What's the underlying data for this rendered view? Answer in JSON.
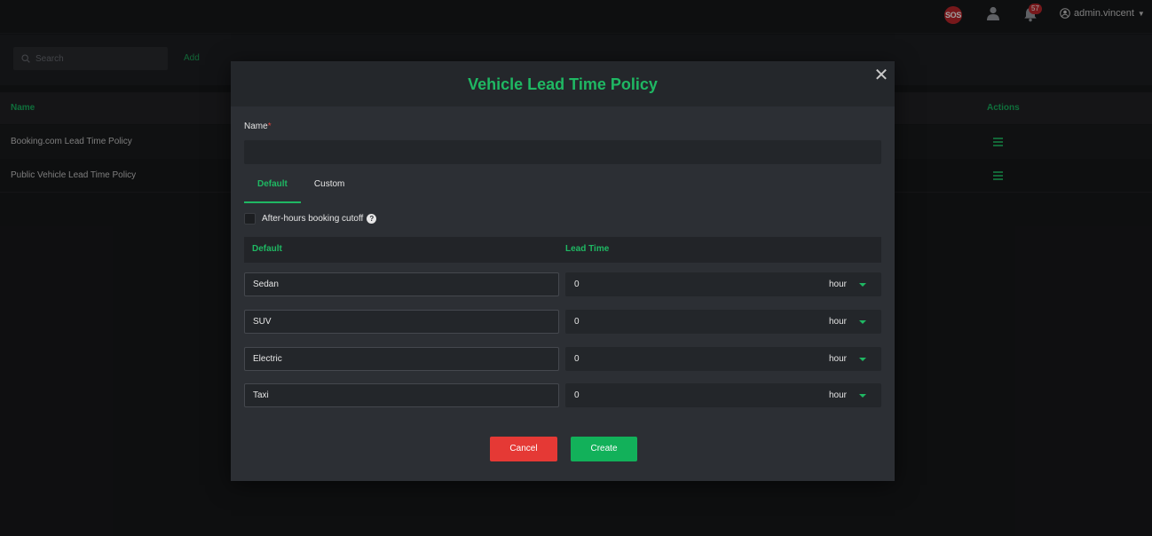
{
  "topbar": {
    "sos_label": "SOS",
    "notification_count": "57",
    "username": "admin.vincent"
  },
  "toolbar": {
    "search_placeholder": "Search",
    "add_label": "Add"
  },
  "table": {
    "columns": {
      "name": "Name",
      "actions": "Actions"
    },
    "rows": [
      {
        "name": "Booking.com Lead Time Policy"
      },
      {
        "name": "Public Vehicle Lead Time Policy"
      }
    ]
  },
  "modal": {
    "title": "Vehicle Lead Time Policy",
    "close_symbol": "✕",
    "name_label": "Name",
    "required_mark": "*",
    "name_value": "",
    "tabs": [
      {
        "label": "Default",
        "active": true
      },
      {
        "label": "Custom",
        "active": false
      }
    ],
    "after_hours_label": "After-hours booking cutoff",
    "after_hours_checked": false,
    "help_symbol": "?",
    "lead_time_table": {
      "col_default": "Default",
      "col_lead_time": "Lead Time",
      "rows": [
        {
          "vehicle": "Sedan",
          "value": "0",
          "unit": "hour"
        },
        {
          "vehicle": "SUV",
          "value": "0",
          "unit": "hour"
        },
        {
          "vehicle": "Electric",
          "value": "0",
          "unit": "hour"
        },
        {
          "vehicle": "Taxi",
          "value": "0",
          "unit": "hour"
        }
      ]
    },
    "cancel_label": "Cancel",
    "create_label": "Create"
  },
  "colors": {
    "accent_green": "#1fb863",
    "danger_red": "#e53935",
    "badge_red": "#c0282d",
    "background": "#18191b",
    "modal_bg": "#2c2f34"
  },
  "icons": {
    "sos": "sos-icon",
    "user": "user-icon",
    "bell": "bell-icon",
    "account": "account-circle-icon",
    "search": "search-icon",
    "row_menu": "hamburger-menu-icon",
    "close": "close-icon",
    "help": "question-circle-icon",
    "dropdown": "chevron-down-icon"
  }
}
